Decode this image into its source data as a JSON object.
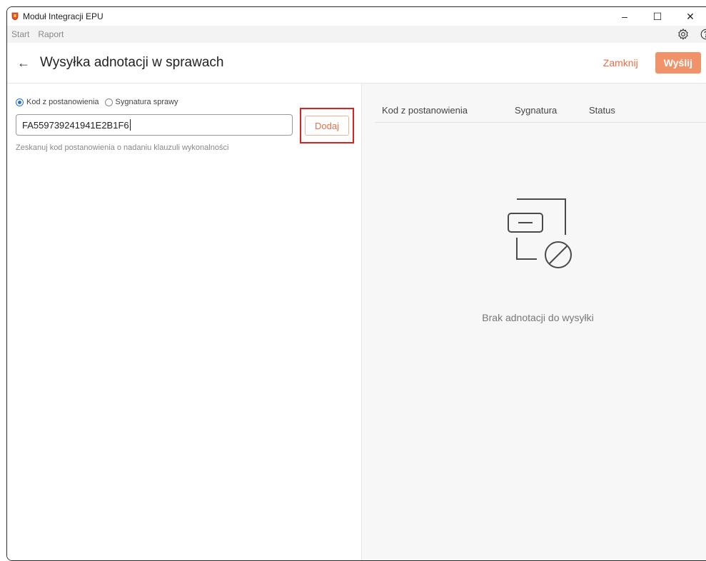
{
  "app": {
    "title": "Moduł Integracji EPU"
  },
  "window_controls": {
    "minimize": "–",
    "maximize": "☐",
    "close": "✕"
  },
  "menu": {
    "items": [
      "Start",
      "Raport"
    ]
  },
  "header": {
    "title": "Wysyłka adnotacji w sprawach",
    "close_label": "Zamknij",
    "send_label": "Wyślij"
  },
  "form": {
    "radio_code_label": "Kod z postanowienia",
    "radio_signature_label": "Sygnatura sprawy",
    "selected_radio": "code",
    "input_value": "FA559739241941E2B1F6",
    "add_label": "Dodaj",
    "hint": "Zeskanuj kod postanowienia o nadaniu klauzuli wykonalności"
  },
  "table": {
    "columns": [
      "Kod z postanowienia",
      "Sygnatura",
      "Status"
    ],
    "empty_message": "Brak adnotacji do wysyłki"
  },
  "colors": {
    "accent": "#e76e45",
    "send_bg": "#f2926b",
    "highlight": "#e02020",
    "radio_selected": "#2a6fd1"
  },
  "icons": {
    "back": "back-arrow-icon",
    "settings": "gear-icon",
    "help": "help-icon",
    "empty": "empty-document-icon"
  }
}
